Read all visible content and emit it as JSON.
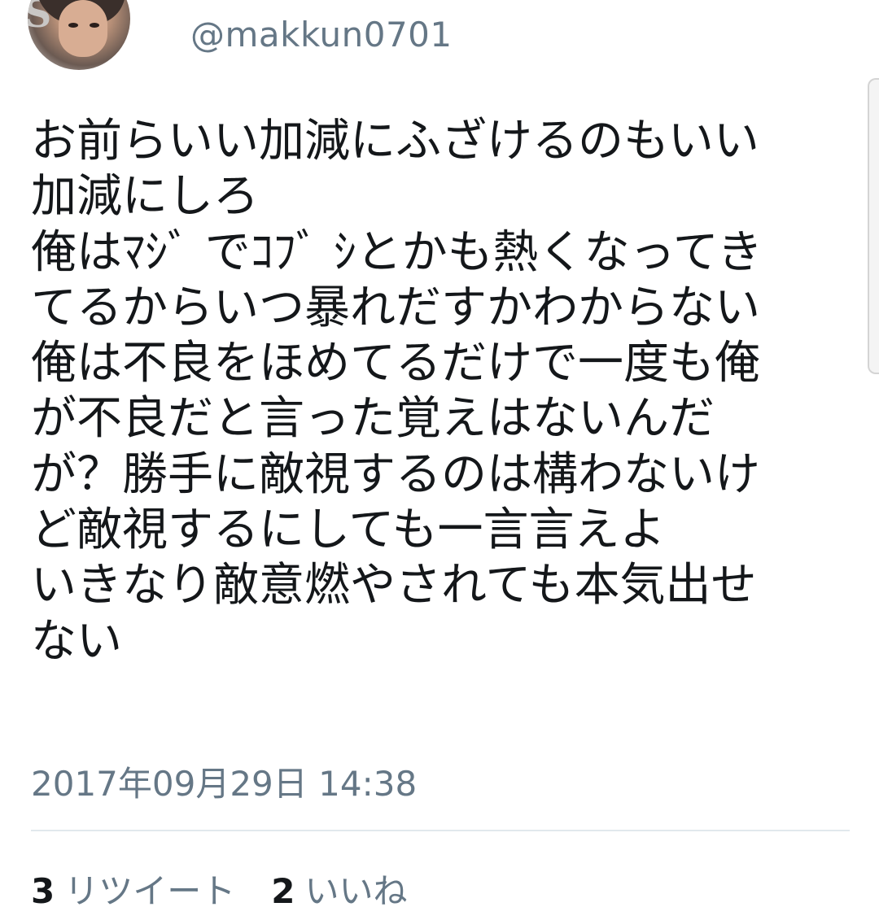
{
  "tweet": {
    "handle": "@makkun0701",
    "text_lines": [
      "お前らいい加減にふざけるのもいい",
      "加減にしろ",
      "俺はﾏｼﾞ でｺﾌﾞ ｼとかも熱くなってき",
      "てるからいつ暴れだすかわからない",
      "俺は不良をほめてるだけで一度も俺",
      "が不良だと言った覚えはないんだ",
      "が？勝手に敵視するのは構わないけ",
      "ど敵視するにしても一言言えよ",
      "いきなり敵意燃やされても本気出せ",
      "ない"
    ],
    "timestamp": "2017年09月29日 14:38"
  },
  "stats": {
    "retweets_count": "3",
    "retweets_label": "リツイート",
    "likes_count": "2",
    "likes_label": "いいね"
  },
  "colors": {
    "text": "#14171a",
    "secondary": "#657786",
    "divider": "#e1e8ed"
  }
}
